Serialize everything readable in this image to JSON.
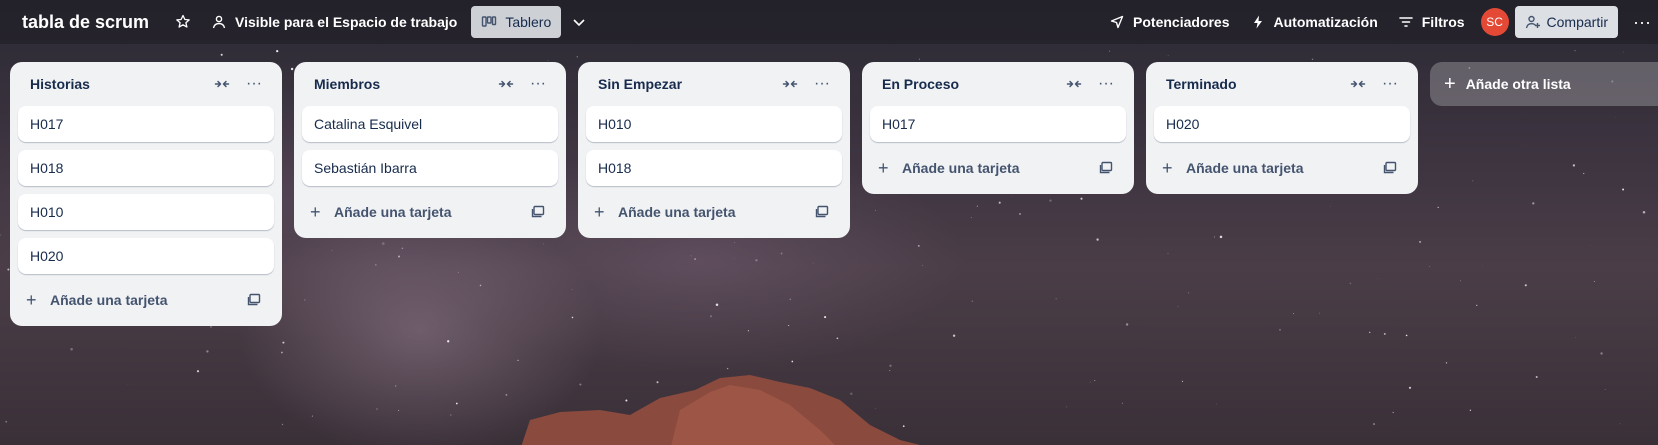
{
  "header": {
    "board_title": "tabla de scrum",
    "visibility_label": "Visible para el Espacio de trabajo",
    "view_label": "Tablero",
    "powerups_label": "Potenciadores",
    "automation_label": "Automatización",
    "filters_label": "Filtros",
    "avatar_initials": "SC",
    "share_label": "Compartir"
  },
  "lists": [
    {
      "title": "Historias",
      "cards": [
        "H017",
        "H018",
        "H010",
        "H020"
      ],
      "add_label": "Añade una tarjeta"
    },
    {
      "title": "Miembros",
      "cards": [
        "Catalina Esquivel",
        "Sebastián Ibarra"
      ],
      "add_label": "Añade una tarjeta"
    },
    {
      "title": "Sin Empezar",
      "cards": [
        "H010",
        "H018"
      ],
      "add_label": "Añade una tarjeta"
    },
    {
      "title": "En Proceso",
      "cards": [
        "H017"
      ],
      "add_label": "Añade una tarjeta"
    },
    {
      "title": "Terminado",
      "cards": [
        "H020"
      ],
      "add_label": "Añade una tarjeta"
    }
  ],
  "add_list_label": "Añade otra lista",
  "colors": {
    "list_bg": "#f1f2f4",
    "avatar_bg": "#e34935",
    "text": "#172b4d"
  }
}
